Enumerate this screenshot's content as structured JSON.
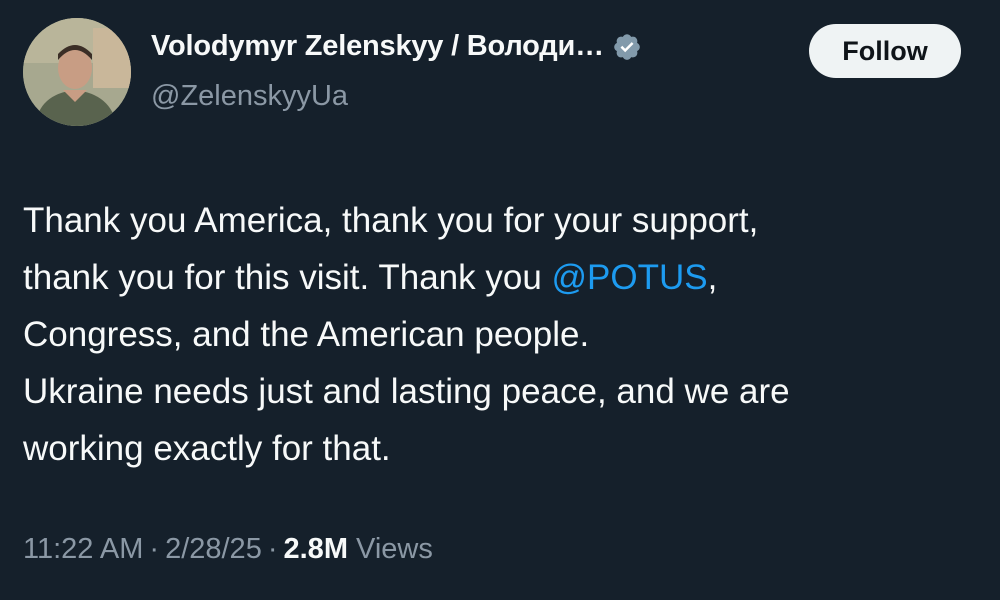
{
  "author": {
    "display_name": "Volodymyr Zelenskyy / Володи…",
    "handle": "@ZelenskyyUa",
    "verified": true,
    "avatar_icon": "profile-photo"
  },
  "follow_button": {
    "label": "Follow"
  },
  "tweet": {
    "lines": [
      {
        "text": "Thank you America, thank you for your support,"
      },
      {
        "text_before": "thank you for this visit. Thank you ",
        "mention": "@POTUS",
        "text_after": ","
      },
      {
        "text": "Congress, and the American people."
      },
      {
        "text": "Ukraine needs just and lasting peace, and we are"
      },
      {
        "text": "working exactly for that."
      }
    ]
  },
  "meta": {
    "time": "11:22 AM",
    "separator": "·",
    "date": "2/28/25",
    "views_count": "2.8M",
    "views_label": "Views"
  },
  "colors": {
    "background": "#15202b",
    "text_primary": "#f7f9f9",
    "text_secondary": "#8b98a5",
    "link": "#1d9bf0",
    "verified_badge": "#829aab",
    "follow_button_bg": "#eff3f4"
  }
}
